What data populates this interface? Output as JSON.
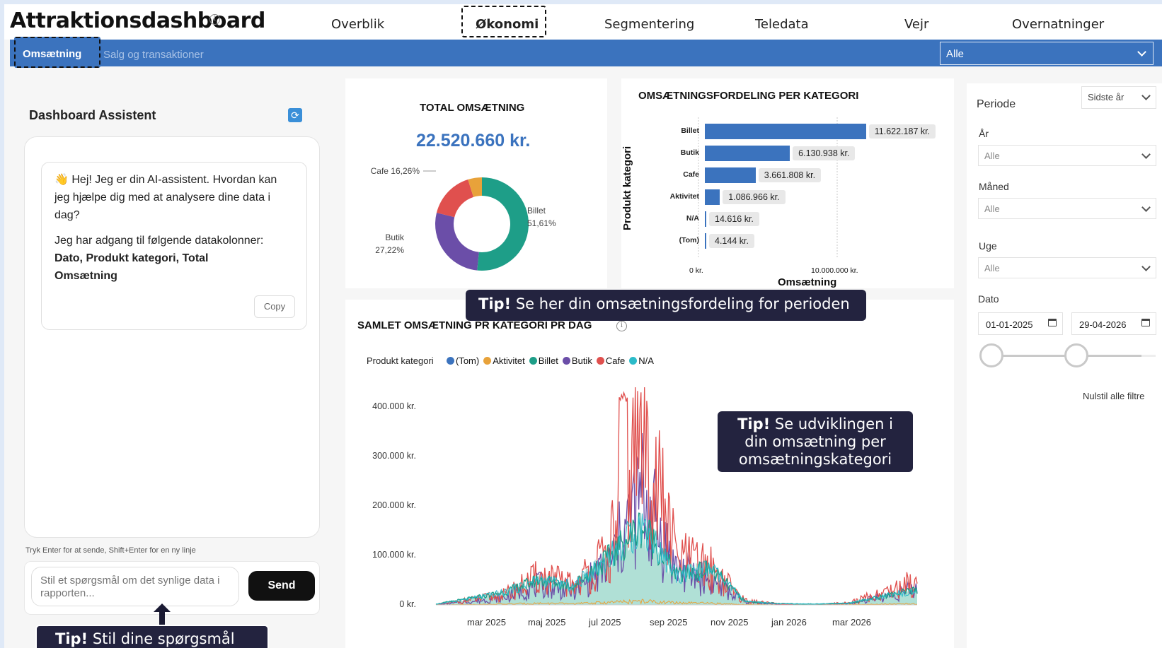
{
  "header": {
    "title": "Attraktionsdashboard",
    "nav": [
      "Overblik",
      "Økonomi",
      "Segmentering",
      "Teledata",
      "Vejr",
      "Overnatninger"
    ],
    "active_nav": "Økonomi"
  },
  "subnav": {
    "tabs": [
      "Omsætning",
      "Salg og transaktioner"
    ],
    "select_value": "Alle"
  },
  "assistant": {
    "title": "Dashboard Assistent",
    "greeting": "👋 Hej! Jeg er din AI-assistent. Hvordan kan jeg hjælpe dig med at analysere dine data i dag?",
    "columns_intro": "Jeg har adgang til følgende datakolonner:",
    "columns": "Dato, Produkt kategori, Total Omsætning",
    "copy_label": "Copy",
    "hint": "Tryk Enter for at sende, Shift+Enter for en ny linje",
    "input_placeholder": "Stil et spørgsmål om det synlige data i rapporten...",
    "send_label": "Send"
  },
  "tips": {
    "tip_word": "Tip!",
    "assistant_tip": "Stil dine spørgsmål til",
    "distribution_tip": "Se her din omsætningsfordeling for perioden",
    "trend_tip": "Se udviklingen i din omsætning per omsætningskategori"
  },
  "kpi": {
    "title": "TOTAL OMSÆTNING",
    "value": "22.520.660 kr."
  },
  "donut": {
    "labels": [
      {
        "name": "Billet",
        "pct": "51,61%"
      },
      {
        "name": "Butik",
        "pct": "27,22%"
      },
      {
        "name": "Cafe",
        "pct": "16,26%"
      }
    ],
    "colors": {
      "Billet": "#1e9e88",
      "Butik": "#6b4ea8",
      "Cafe": "#e0504e",
      "Aktivitet": "#e8a23a"
    }
  },
  "bar_chart": {
    "title": "OMSÆTNINGSFORDELING PER KATEGORI",
    "ylabel": "Produkt kategori",
    "xlabel": "Omsætning",
    "xticks": [
      "0 kr.",
      "10.000.000 kr."
    ]
  },
  "line_chart": {
    "title": "SAMLET OMSÆTNING PR KATEGORI PR DAG",
    "legend_title": "Produkt kategori",
    "legend": [
      {
        "name": "(Tom)",
        "color": "#3b73be"
      },
      {
        "name": "Aktivitet",
        "color": "#e8a23a"
      },
      {
        "name": "Billet",
        "color": "#1e9e88"
      },
      {
        "name": "Butik",
        "color": "#6b4ea8"
      },
      {
        "name": "Cafe",
        "color": "#e0504e"
      },
      {
        "name": "N/A",
        "color": "#2bbbc9"
      }
    ],
    "yticks": [
      "400.000 kr.",
      "300.000 kr.",
      "200.000 kr.",
      "100.000 kr.",
      "0 kr."
    ],
    "xticks": [
      "mar 2025",
      "maj 2025",
      "jul 2025",
      "sep 2025",
      "nov 2025",
      "jan 2026",
      "mar 2026"
    ]
  },
  "filters": {
    "period_label": "Periode",
    "period_value": "Sidste år",
    "year_label": "År",
    "month_label": "Måned",
    "week_label": "Uge",
    "all_value": "Alle",
    "date_label": "Dato",
    "date_from": "01-01-2025",
    "date_to": "29-04-2026",
    "reset_label": "Nulstil alle filtre"
  },
  "chart_data": [
    {
      "type": "pie",
      "categories": [
        "Billet",
        "Butik",
        "Cafe",
        "Aktivitet"
      ],
      "values": [
        51.61,
        27.22,
        16.26,
        4.83
      ],
      "title": "TOTAL OMSÆTNING"
    },
    {
      "type": "bar",
      "title": "OMSÆTNINGSFORDELING PER KATEGORI",
      "categories": [
        "Billet",
        "Butik",
        "Cafe",
        "Aktivitet",
        "N/A",
        "(Tom)"
      ],
      "values": [
        11622187,
        6130938,
        3661808,
        1086966,
        14616,
        4144
      ],
      "value_labels": [
        "11.622.187 kr.",
        "6.130.938 kr.",
        "3.661.808 kr.",
        "1.086.966 kr.",
        "14.616 kr.",
        "4.144 kr."
      ],
      "xlabel": "Omsætning",
      "ylabel": "Produkt kategori",
      "xlim": [
        0,
        13000000
      ]
    },
    {
      "type": "line",
      "title": "SAMLET OMSÆTNING PR KATEGORI PR DAG",
      "ylim": [
        0,
        450000
      ],
      "x": [
        "2025-02",
        "2025-03",
        "2025-04",
        "2025-05",
        "2025-06",
        "2025-07",
        "2025-08",
        "2025-09",
        "2025-10",
        "2025-11",
        "2025-12",
        "2026-01",
        "2026-02",
        "2026-03",
        "2026-04"
      ],
      "series": [
        {
          "name": "Billet",
          "values": [
            2000,
            15000,
            30000,
            60000,
            45000,
            110000,
            190000,
            70000,
            85000,
            8000,
            3000,
            2000,
            4000,
            20000,
            35000
          ]
        },
        {
          "name": "Cafe",
          "values": [
            1000,
            12000,
            25000,
            70000,
            50000,
            120000,
            440000,
            120000,
            90000,
            10000,
            2000,
            1000,
            5000,
            30000,
            60000
          ]
        },
        {
          "name": "Butik",
          "values": [
            500,
            8000,
            18000,
            50000,
            35000,
            95000,
            280000,
            90000,
            60000,
            7000,
            1500,
            800,
            3000,
            20000,
            40000
          ]
        },
        {
          "name": "Aktivitet",
          "values": [
            0,
            1000,
            2000,
            4000,
            3000,
            6000,
            9000,
            5000,
            4000,
            1000,
            0,
            0,
            500,
            2000,
            3000
          ]
        }
      ]
    }
  ]
}
